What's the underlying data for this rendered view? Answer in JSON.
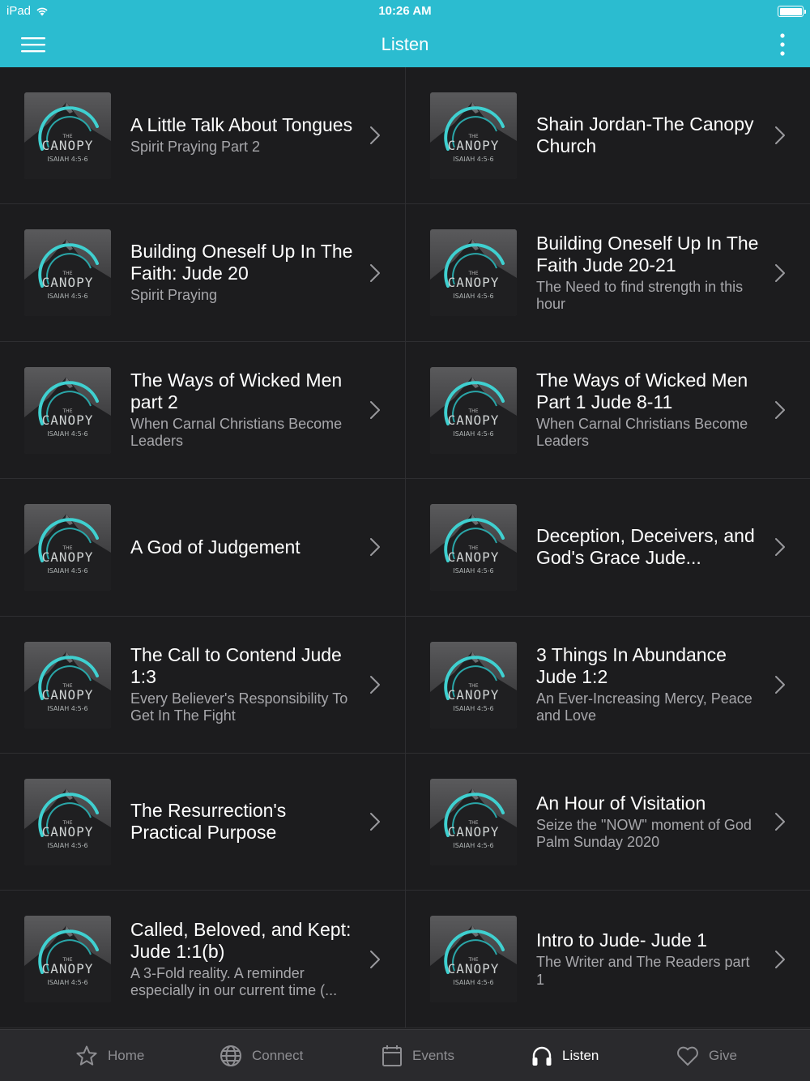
{
  "status_bar": {
    "device": "iPad",
    "time": "10:26 AM"
  },
  "nav": {
    "title": "Listen"
  },
  "thumbnail": {
    "brand": "CANOPY",
    "small": "THE",
    "verse": "ISAIAH 4:5-6",
    "accent": "#3fd0d0"
  },
  "items": [
    {
      "title": "A Little Talk About Tongues",
      "subtitle": "Spirit Praying Part 2"
    },
    {
      "title": "Shain Jordan-The Canopy Church",
      "subtitle": ""
    },
    {
      "title": "Building Oneself Up In The Faith: Jude 20",
      "subtitle": "Spirit Praying"
    },
    {
      "title": "Building Oneself Up In The Faith Jude 20-21",
      "subtitle": "The Need to find strength in this hour"
    },
    {
      "title": "The Ways of Wicked Men part 2",
      "subtitle": "When Carnal Christians Become Leaders"
    },
    {
      "title": "The Ways of Wicked Men Part 1 Jude 8-11",
      "subtitle": "When Carnal Christians Become Leaders"
    },
    {
      "title": "A God of Judgement",
      "subtitle": ""
    },
    {
      "title": "Deception, Deceivers, and God's Grace Jude...",
      "subtitle": ""
    },
    {
      "title": "The Call to Contend Jude 1:3",
      "subtitle": "Every Believer's Responsibility To Get In The Fight"
    },
    {
      "title": "3 Things In Abundance Jude 1:2",
      "subtitle": "An Ever-Increasing Mercy, Peace and Love"
    },
    {
      "title": "The Resurrection's Practical Purpose",
      "subtitle": ""
    },
    {
      "title": "An Hour of Visitation",
      "subtitle": "Seize the \"NOW\" moment of God Palm Sunday 2020"
    },
    {
      "title": "Called, Beloved, and Kept: Jude 1:1(b)",
      "subtitle": "A 3-Fold reality. A reminder especially in our current time (..."
    },
    {
      "title": "Intro to Jude- Jude 1",
      "subtitle": "The Writer and The Readers part 1"
    }
  ],
  "tabs": [
    {
      "label": "Home",
      "icon": "star-icon",
      "active": false
    },
    {
      "label": "Connect",
      "icon": "globe-icon",
      "active": false
    },
    {
      "label": "Events",
      "icon": "calendar-icon",
      "active": false
    },
    {
      "label": "Listen",
      "icon": "headphones-icon",
      "active": true
    },
    {
      "label": "Give",
      "icon": "heart-icon",
      "active": false
    }
  ],
  "colors": {
    "header": "#2bbcd0",
    "background": "#1c1c1e",
    "tab_bar": "#2a2a2d",
    "subtitle": "#a7a7ab"
  }
}
